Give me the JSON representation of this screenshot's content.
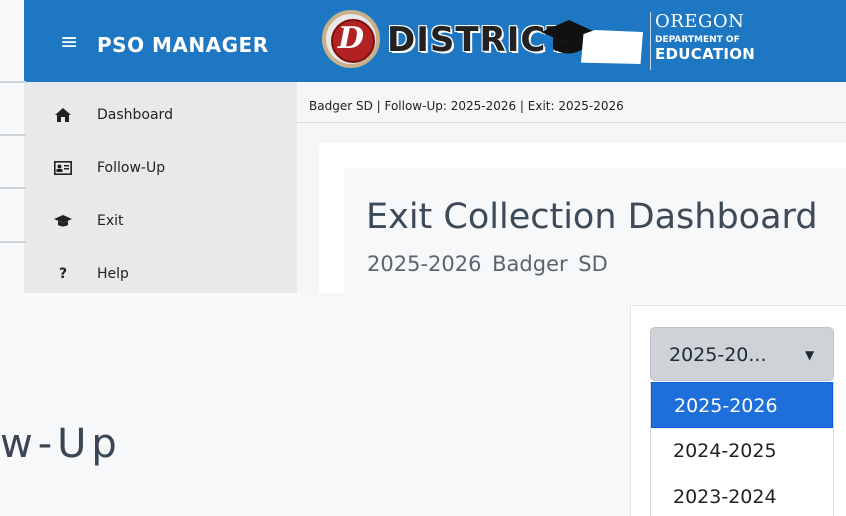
{
  "header": {
    "menu_icon": "hamburger-menu-icon",
    "app_title": "PSO MANAGER",
    "logo": {
      "district_letter": "D",
      "district_word": "DISTRICT",
      "agency_state": "OREGON",
      "agency_dept": "DEPARTMENT OF",
      "agency_edu": "EDUCATION"
    },
    "color": "#1e77c2"
  },
  "sidebar": {
    "items": [
      {
        "label": "Dashboard",
        "icon": "home-icon"
      },
      {
        "label": "Follow-Up",
        "icon": "id-card-icon"
      },
      {
        "label": "Exit",
        "icon": "graduation-cap-icon"
      },
      {
        "label": "Help",
        "icon": "question-icon"
      }
    ]
  },
  "breadcrumb": "Badger SD | Follow-Up: 2025-2026 | Exit: 2025-2026",
  "main": {
    "title": "Exit Collection Dashboard",
    "subtitle": "2025-2026  Badger SD"
  },
  "zoom": {
    "fragment_text": "w-Up",
    "year_select": {
      "current_value": "2025-20...",
      "caret_icon": "caret-down-icon",
      "options": [
        "2025-2026",
        "2024-2025",
        "2023-2024"
      ],
      "selected_index": 0,
      "selected_color": "#1e6fd9"
    }
  }
}
